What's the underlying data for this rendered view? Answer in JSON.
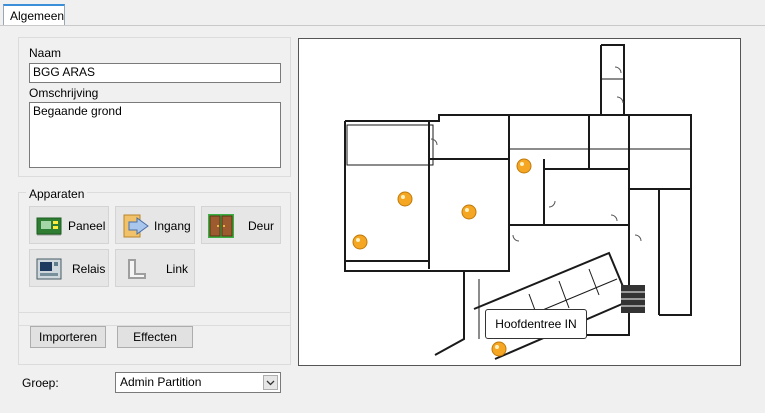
{
  "tab": {
    "label": "Algemeen"
  },
  "naam": {
    "label": "Naam",
    "value": "BGG ARAS"
  },
  "omschrijving": {
    "label": "Omschrijving",
    "value": "Begaande grond"
  },
  "apparaten": {
    "label": "Apparaten",
    "tools": [
      {
        "label": "Paneel",
        "icon": "panel-icon"
      },
      {
        "label": "Ingang",
        "icon": "entrance-icon"
      },
      {
        "label": "Deur",
        "icon": "door-icon"
      },
      {
        "label": "Relais",
        "icon": "relay-icon"
      },
      {
        "label": "Link",
        "icon": "link-icon"
      }
    ]
  },
  "actions": {
    "import_label": "Importeren",
    "effects_label": "Effecten"
  },
  "groep": {
    "label": "Groep:",
    "value": "Admin Partition"
  },
  "map": {
    "tooltip": "Hoofdentree IN",
    "marker_color": "#f5a623"
  }
}
